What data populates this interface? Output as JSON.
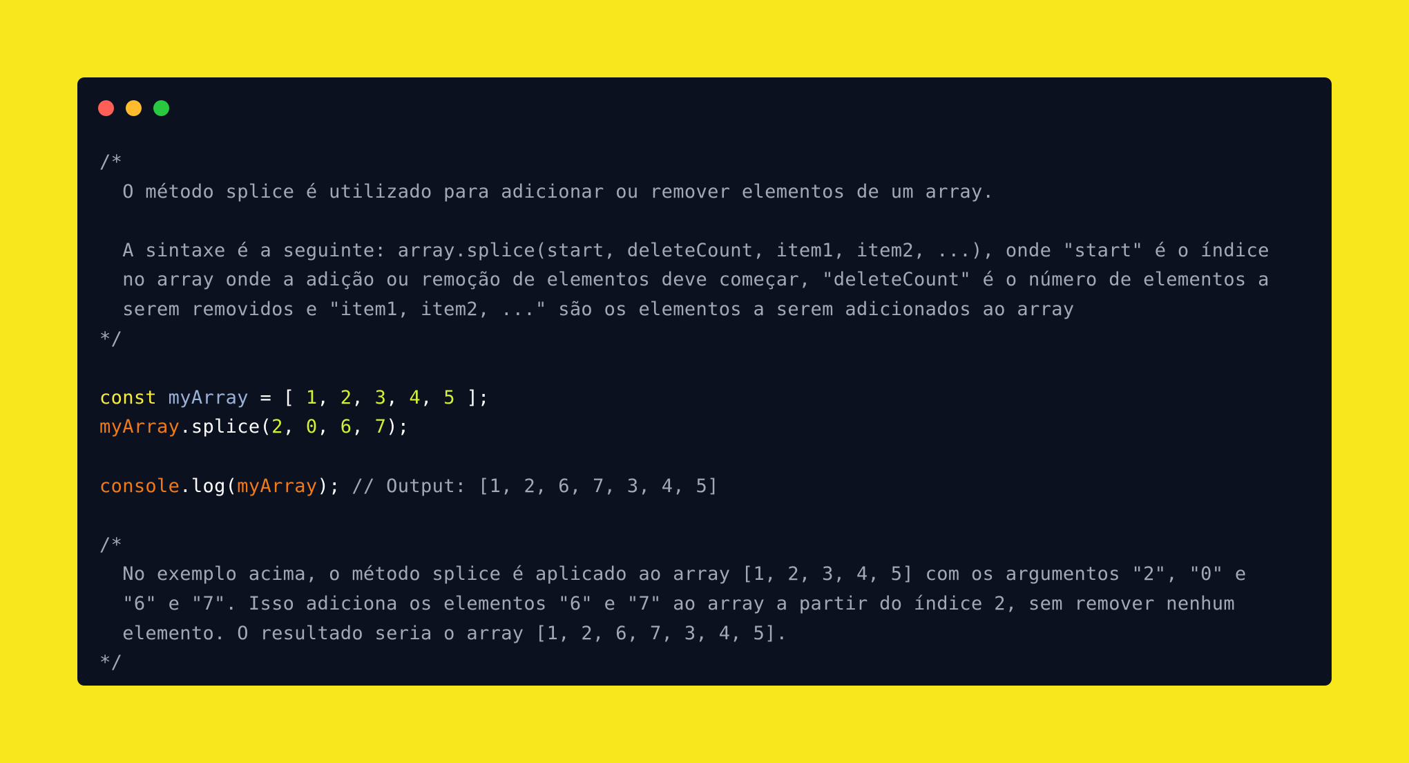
{
  "window": {
    "controls": [
      "close",
      "minimize",
      "maximize"
    ]
  },
  "colors": {
    "background": "#f9e71e",
    "window": "#0c1120",
    "comment": "#a4a8b4",
    "keyword": "#f7ec40",
    "variable": "#9ab2d6",
    "number": "#d2f034",
    "object": "#f07a1a",
    "text": "#ffffff"
  },
  "code": {
    "comment1": {
      "open": "/*",
      "line1": "  O método splice é utilizado para adicionar ou remover elementos de um array.",
      "line2": "",
      "line3": "  A sintaxe é a seguinte: array.splice(start, deleteCount, item1, item2, ...), onde \"start\" é o índice",
      "line4": "  no array onde a adição ou remoção de elementos deve começar, \"deleteCount\" é o número de elementos a",
      "line5": "  serem removidos e \"item1, item2, ...\" são os elementos a serem adicionados ao array",
      "close": "*/"
    },
    "decl": {
      "keyword": "const",
      "name": "myArray",
      "assign": " = [ ",
      "values": [
        "1",
        "2",
        "3",
        "4",
        "5"
      ],
      "sep": ", ",
      "end": " ];"
    },
    "splice": {
      "object": "myArray",
      "method": ".splice(",
      "args": [
        "2",
        "0",
        "6",
        "7"
      ],
      "sep": ", ",
      "end": ");"
    },
    "log": {
      "object": "console",
      "method": ".log(",
      "arg": "myArray",
      "end": "); ",
      "comment": "// Output: [1, 2, 6, 7, 3, 4, 5]"
    },
    "comment2": {
      "open": "/*",
      "line1": "  No exemplo acima, o método splice é aplicado ao array [1, 2, 3, 4, 5] com os argumentos \"2\", \"0\" e",
      "line2": "  \"6\" e \"7\". Isso adiciona os elementos \"6\" e \"7\" ao array a partir do índice 2, sem remover nenhum",
      "line3": "  elemento. O resultado seria o array [1, 2, 6, 7, 3, 4, 5].",
      "close": "*/"
    }
  }
}
